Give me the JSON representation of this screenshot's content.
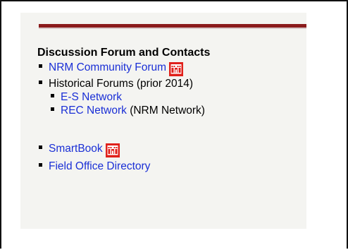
{
  "section": {
    "heading": "Discussion Forum and Contacts"
  },
  "items": [
    {
      "label": "NRM Community Forum",
      "icon": "usace-castle-icon"
    },
    {
      "label": "Historical Forums (prior 2014)"
    },
    {
      "label": "E-S Network"
    },
    {
      "label": "REC Network",
      "suffix": " (NRM Network)"
    },
    {
      "label": "SmartBook",
      "icon": "usace-castle-icon"
    },
    {
      "label": "Field Office Directory"
    }
  ],
  "colors": {
    "link": "#1a2fd6",
    "rule": "#8b1c1c",
    "icon_red": "#e0211b",
    "panel_background": "#f4f4f1"
  }
}
